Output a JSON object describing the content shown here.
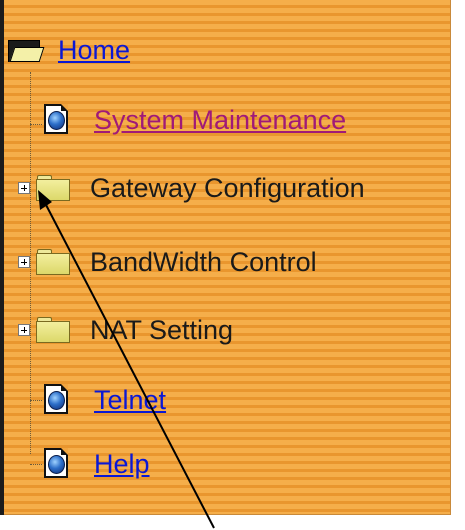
{
  "tree": {
    "home": {
      "label": "Home",
      "icon": "open-folder-icon"
    },
    "items": [
      {
        "label": "System Maintenance",
        "type": "page",
        "icon": "web-page-icon",
        "style": "visited-link"
      },
      {
        "label": "Gateway Configuration",
        "type": "folder",
        "icon": "folder-icon",
        "expander": "+"
      },
      {
        "label": "BandWidth Control",
        "type": "folder",
        "icon": "folder-icon",
        "expander": "+"
      },
      {
        "label": "NAT Setting",
        "type": "folder",
        "icon": "folder-icon",
        "expander": "+"
      },
      {
        "label": "Telnet",
        "type": "page",
        "icon": "web-page-icon",
        "style": "link"
      },
      {
        "label": "Help",
        "type": "page",
        "icon": "web-page-icon",
        "style": "link"
      }
    ]
  },
  "colors": {
    "background_stripe_light": "#f5ae4a",
    "background_stripe_dark": "#e9962e",
    "link": "#0b18d4",
    "visited_link": "#a01a78",
    "text": "#1a1a1a"
  },
  "annotation": {
    "icon": "pointer-arrow-icon"
  }
}
